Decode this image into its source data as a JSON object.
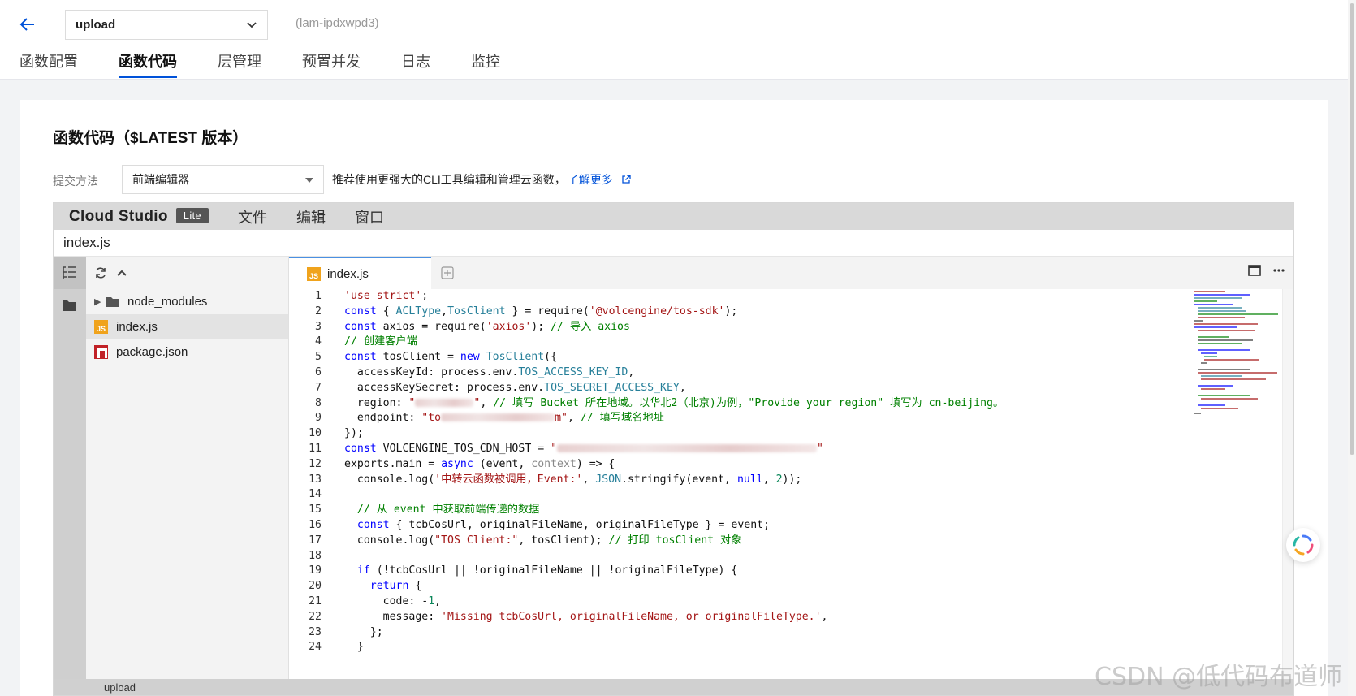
{
  "header": {
    "function_name": "upload",
    "function_id": "(lam-ipdxwpd3)",
    "tabs": [
      {
        "label": "函数配置",
        "active": false
      },
      {
        "label": "函数代码",
        "active": true
      },
      {
        "label": "层管理",
        "active": false
      },
      {
        "label": "预置并发",
        "active": false
      },
      {
        "label": "日志",
        "active": false
      },
      {
        "label": "监控",
        "active": false
      }
    ]
  },
  "card": {
    "title": "函数代码（$LATEST 版本）",
    "submit_label": "提交方法",
    "submit_value": "前端编辑器",
    "hint_text": "推荐使用更强大的CLI工具编辑和管理云函数，",
    "hint_link": "了解更多"
  },
  "ide": {
    "brand": "Cloud Studio",
    "brand_badge": "Lite",
    "menu": [
      "文件",
      "编辑",
      "窗口"
    ],
    "open_file_title": "index.js",
    "tree": [
      {
        "label": "node_modules",
        "type": "folder"
      },
      {
        "label": "index.js",
        "type": "js",
        "selected": true
      },
      {
        "label": "package.json",
        "type": "npm"
      }
    ],
    "editor_tab": "index.js",
    "status_label": "upload"
  },
  "code": {
    "l1": {
      "n": "1",
      "a": "'use strict'",
      "b": ";"
    },
    "l2": {
      "n": "2",
      "kw": "const",
      "a": " { ",
      "t1": "ACLType",
      "c": ",",
      "t2": "TosClient",
      "d": " } = require(",
      "s": "'@volcengine/tos-sdk'",
      "e": ");"
    },
    "l3": {
      "n": "3",
      "kw": "const",
      "a": " axios = require(",
      "s": "'axios'",
      "b": "); ",
      "cm": "// 导入 axios"
    },
    "l4": {
      "n": "4",
      "cm": "// 创建客户端"
    },
    "l5": {
      "n": "5",
      "kw": "const",
      "a": " tosClient = ",
      "kw2": "new",
      "b": " ",
      "t": "TosClient",
      "c": "({"
    },
    "l6": {
      "n": "6",
      "a": "  accessKeyId: process.env.",
      "t": "TOS_ACCESS_KEY_ID",
      "b": ","
    },
    "l7": {
      "n": "7",
      "a": "  accessKeySecret: process.env.",
      "t": "TOS_SECRET_ACCESS_KEY",
      "b": ","
    },
    "l8": {
      "n": "8",
      "a": "  region: ",
      "s1": "\"",
      "s2": "\"",
      "b": ", ",
      "cm": "// 填写 Bucket 所在地域。以华北2（北京)为例，\"Provide your region\" 填写为 cn-beijing。"
    },
    "l9": {
      "n": "9",
      "a": "  endpoint: ",
      "s1": "\"to",
      "s2": "m\"",
      "b": ", ",
      "cm": "// 填写域名地址"
    },
    "l10": {
      "n": "10",
      "a": "});"
    },
    "l11": {
      "n": "11",
      "kw": "const",
      "a": " VOLCENGINE_TOS_CDN_HOST = ",
      "s1": "\"",
      "s2": "\""
    },
    "l12": {
      "n": "12",
      "a": "exports.main = ",
      "kw": "async",
      "b": " (event, ",
      "mu": "context",
      "c": ") => {"
    },
    "l13": {
      "n": "13",
      "a": "  console.log(",
      "s": "'中转云函数被调用，Event:'",
      "b": ", ",
      "t": "JSON",
      "c": ".stringify(event, ",
      "kw": "null",
      "d": ", ",
      "nu": "2",
      "e": "));"
    },
    "l14": {
      "n": "14"
    },
    "l15": {
      "n": "15",
      "cm": "  // 从 event 中获取前端传递的数据"
    },
    "l16": {
      "n": "16",
      "kw": "  const",
      "a": " { tcbCosUrl, originalFileName, originalFileType } = event;"
    },
    "l17": {
      "n": "17",
      "a": "  console.log(",
      "s": "\"TOS Client:\"",
      "b": ", tosClient); ",
      "cm": "// 打印 tosClient 对象"
    },
    "l18": {
      "n": "18"
    },
    "l19": {
      "n": "19",
      "kw": "  if",
      "a": " (!tcbCosUrl || !originalFileName || !originalFileType) {"
    },
    "l20": {
      "n": "20",
      "kw": "    return",
      "a": " {"
    },
    "l21": {
      "n": "21",
      "a": "      code: -",
      "nu": "1",
      "b": ","
    },
    "l22": {
      "n": "22",
      "a": "      message: ",
      "s": "'Missing tcbCosUrl, originalFileName, or originalFileType.'",
      "b": ","
    },
    "l23": {
      "n": "23",
      "a": "    };"
    },
    "l24": {
      "n": "24",
      "a": "  }"
    }
  },
  "watermark": "CSDN @低代码布道师",
  "colors": {
    "accent": "#0052d9",
    "js_badge": "#f0a31c",
    "npm_badge": "#c12127"
  }
}
